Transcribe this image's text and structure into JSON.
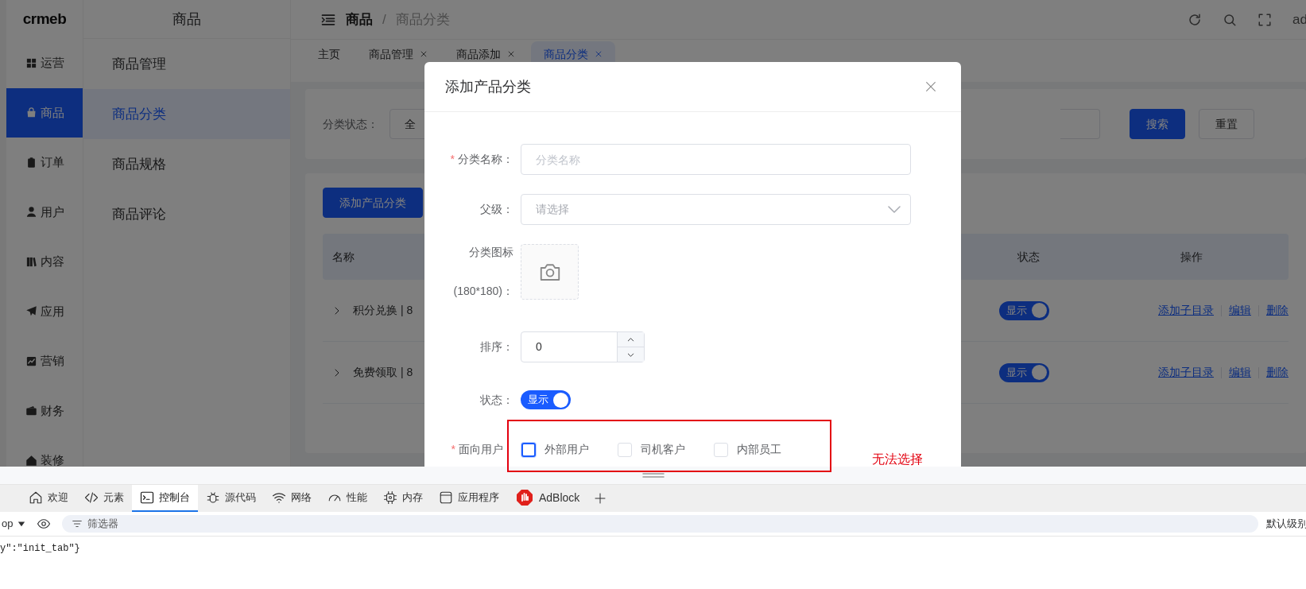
{
  "sidebar": {
    "logo": "crmeb",
    "items": [
      {
        "label": "运营",
        "selected": false
      },
      {
        "label": "商品",
        "selected": true
      },
      {
        "label": "订单",
        "selected": false
      },
      {
        "label": "用户",
        "selected": false
      },
      {
        "label": "内容",
        "selected": false
      },
      {
        "label": "应用",
        "selected": false
      },
      {
        "label": "营销",
        "selected": false
      },
      {
        "label": "财务",
        "selected": false
      },
      {
        "label": "装修",
        "selected": false
      }
    ]
  },
  "submenu": {
    "title": "商品",
    "items": [
      {
        "label": "商品管理",
        "selected": false
      },
      {
        "label": "商品分类",
        "selected": true
      },
      {
        "label": "商品规格",
        "selected": false
      },
      {
        "label": "商品评论",
        "selected": false
      }
    ]
  },
  "header": {
    "breadcrumb": [
      "商品",
      "商品分类"
    ],
    "breadcrumb_separator": "/",
    "user_name": "ad"
  },
  "tabs": [
    {
      "label": "主页",
      "closable": false,
      "selected": false
    },
    {
      "label": "商品管理",
      "closable": true,
      "selected": false
    },
    {
      "label": "商品添加",
      "closable": true,
      "selected": false
    },
    {
      "label": "商品分类",
      "closable": true,
      "selected": true
    }
  ],
  "filter": {
    "label": "分类状态：",
    "select_value": "全",
    "buttons": [
      {
        "label": "搜索",
        "kind": "primary"
      },
      {
        "label": "重置",
        "kind": "default"
      }
    ]
  },
  "table": {
    "add_button": "添加产品分类",
    "columns": [
      "名称",
      "状态",
      "操作"
    ],
    "rows": [
      {
        "name": "积分兑换 | 8",
        "status": {
          "label": "显示",
          "on": true
        },
        "actions": [
          "添加子目录",
          "编辑",
          "删除"
        ]
      },
      {
        "name": "免费领取 | 8",
        "status": {
          "label": "显示",
          "on": true
        },
        "actions": [
          "添加子目录",
          "编辑",
          "删除"
        ]
      }
    ]
  },
  "modal": {
    "title": "添加产品分类",
    "required_mark": "*",
    "fields": [
      {
        "kind": "text",
        "label": "分类名称：",
        "required": true,
        "placeholder": "分类名称"
      },
      {
        "kind": "select",
        "label": "父级：",
        "required": false,
        "placeholder": "请选择"
      },
      {
        "kind": "upload",
        "label": "分类图标",
        "sublabel": "(180*180)：",
        "required": false
      },
      {
        "kind": "number",
        "label": "排序：",
        "required": false,
        "value": "0"
      },
      {
        "kind": "switch",
        "label": "状态：",
        "required": false,
        "switch_label": "显示",
        "on": true
      },
      {
        "kind": "checkboxes",
        "label": "面向用户",
        "required": true,
        "options": [
          {
            "label": "外部用户",
            "checked": false,
            "focused": true
          },
          {
            "label": "司机客户",
            "checked": false,
            "focused": false
          },
          {
            "label": "内部员工",
            "checked": false,
            "focused": false
          }
        ]
      }
    ]
  },
  "annotation": {
    "text": "无法选择"
  },
  "devtools": {
    "tabs": [
      {
        "label": "欢迎",
        "selected": false
      },
      {
        "label": "元素",
        "selected": false
      },
      {
        "label": "控制台",
        "selected": true
      },
      {
        "label": "源代码",
        "selected": false
      },
      {
        "label": "网络",
        "selected": false
      },
      {
        "label": "性能",
        "selected": false
      },
      {
        "label": "内存",
        "selected": false
      },
      {
        "label": "应用程序",
        "selected": false
      },
      {
        "label": "AdBlock",
        "selected": false
      }
    ],
    "context": "op",
    "filter_placeholder": "筛选器",
    "level": "默认级别",
    "console_lines": [
      "y\":\"init_tab\"}"
    ]
  }
}
